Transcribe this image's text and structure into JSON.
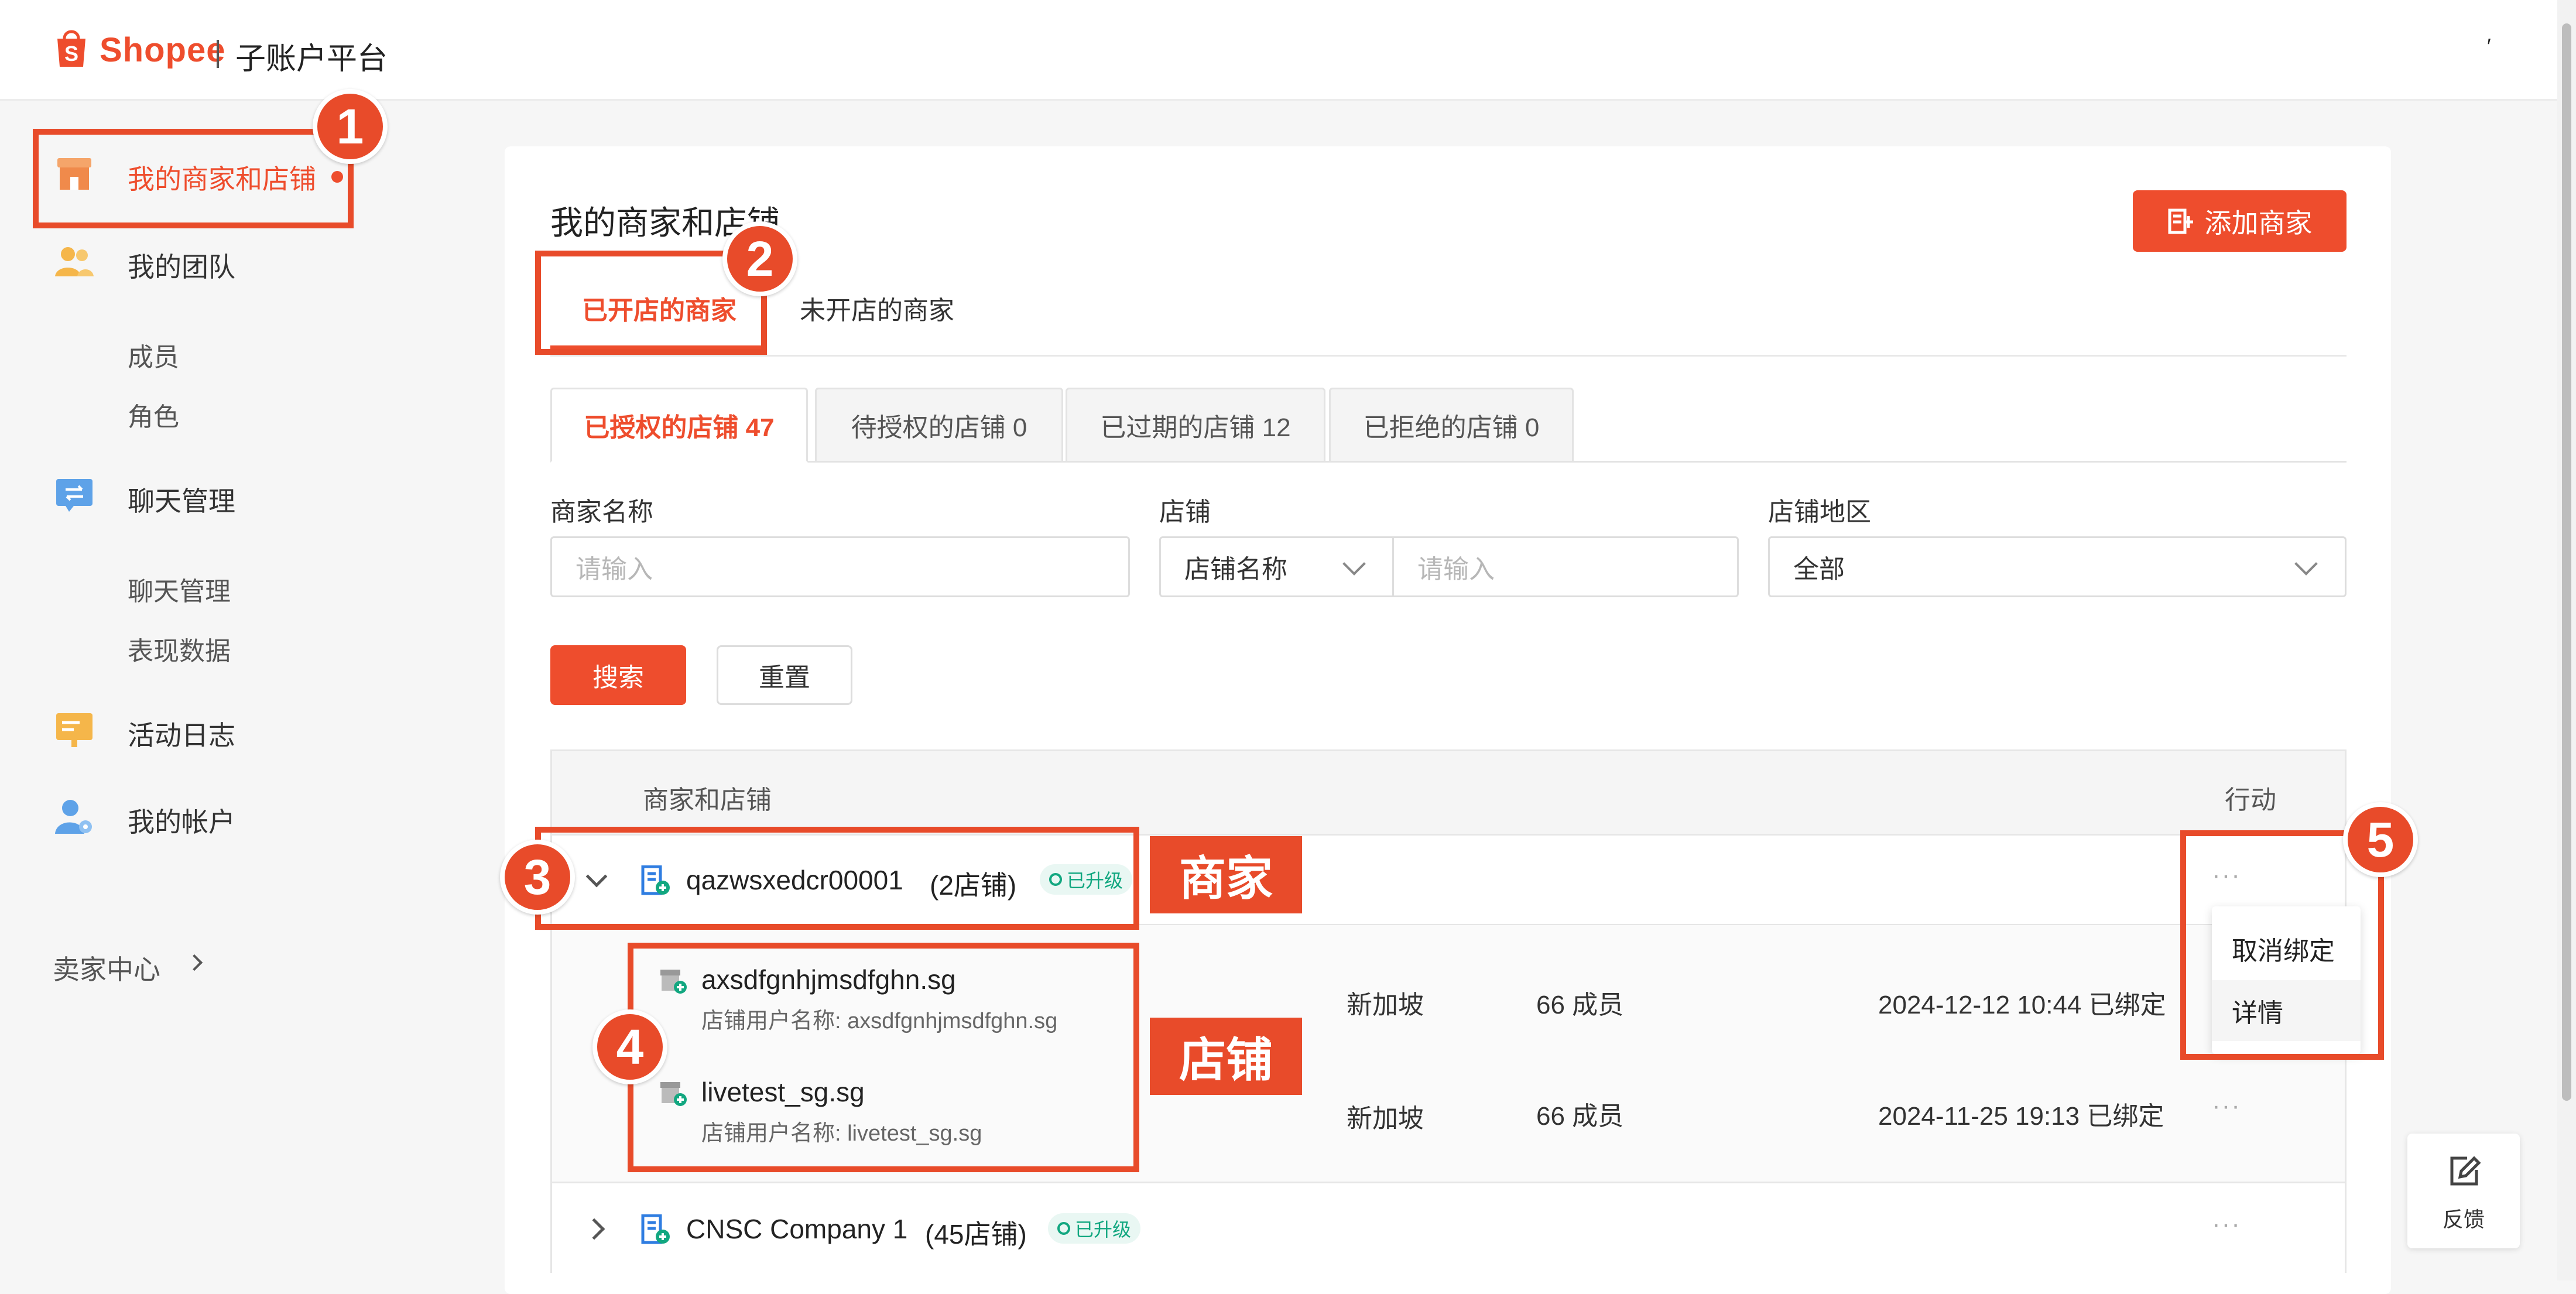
{
  "header": {
    "brand": "Shopee",
    "platform": "子账户平台",
    "corner_mark": "′"
  },
  "sidebar": {
    "items": [
      {
        "label": "我的商家和店铺",
        "icon": "store-icon"
      },
      {
        "label": "我的团队",
        "icon": "team-icon",
        "children": [
          "成员",
          "角色"
        ]
      },
      {
        "label": "聊天管理",
        "icon": "chat-icon",
        "children": [
          "聊天管理",
          "表现数据"
        ]
      },
      {
        "label": "活动日志",
        "icon": "log-icon"
      },
      {
        "label": "我的帐户",
        "icon": "account-icon"
      }
    ],
    "seller_center": "卖家中心"
  },
  "main": {
    "title": "我的商家和店铺",
    "add_button": "添加商家",
    "tabs": [
      "已开店的商家",
      "未开店的商家"
    ],
    "subtabs": [
      "已授权的店铺 47",
      "待授权的店铺 0",
      "已过期的店铺 12",
      "已拒绝的店铺 0"
    ],
    "filters": {
      "merchant_label": "商家名称",
      "merchant_placeholder": "请输入",
      "shop_label": "店铺",
      "shop_type": "店铺名称",
      "shop_placeholder": "请输入",
      "region_label": "店铺地区",
      "region_value": "全部"
    },
    "search_button": "搜索",
    "reset_button": "重置",
    "table": {
      "col_merchant": "商家和店铺",
      "col_action": "行动",
      "merchants": [
        {
          "name": "qazwsxedcr00001",
          "count": "(2店铺)",
          "badge": "已升级",
          "shops": [
            {
              "name": "axsdfgnhjmsdfghn.sg",
              "user": "店铺用户名称: axsdfgnhjmsdfghn.sg",
              "region": "新加坡",
              "members": "66 成员",
              "bound": "2024-12-12 10:44 已绑定"
            },
            {
              "name": "livetest_sg.sg",
              "user": "店铺用户名称: livetest_sg.sg",
              "region": "新加坡",
              "members": "66 成员",
              "bound": "2024-11-25 19:13 已绑定"
            }
          ]
        },
        {
          "name": "CNSC Company 1",
          "count": "(45店铺)",
          "badge": "已升级"
        }
      ],
      "action_menu": [
        "取消绑定",
        "详情"
      ],
      "more": "···"
    }
  },
  "annotations": {
    "markers": [
      "1",
      "2",
      "3",
      "4",
      "5"
    ],
    "merchant_tag": "商家",
    "shop_tag": "店铺"
  },
  "feedback": {
    "label": "反馈"
  },
  "colors": {
    "accent": "#ee4d2d",
    "annotation": "#e84b2a",
    "badge": "#12a780"
  }
}
